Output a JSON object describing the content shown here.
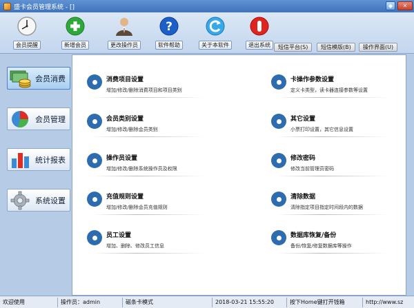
{
  "window": {
    "title": "盛卡会员管理系统 - []"
  },
  "toolbar": [
    {
      "label": "会员提醒",
      "icon": "clock-icon"
    },
    {
      "label": "新增会员",
      "icon": "plus-icon"
    },
    {
      "label": "更改操作员",
      "icon": "operator-icon"
    },
    {
      "label": "软件帮助",
      "icon": "help-icon"
    },
    {
      "label": "关于本软件",
      "icon": "about-icon"
    },
    {
      "label": "退出系统",
      "icon": "power-icon"
    }
  ],
  "right_tabs": [
    {
      "label": "短信平台(S)"
    },
    {
      "label": "短信模版(B)"
    },
    {
      "label": "操作界面(U)"
    }
  ],
  "nav": [
    {
      "label": "会员消费",
      "icon": "money-icon"
    },
    {
      "label": "会员管理",
      "icon": "pie-chart-icon"
    },
    {
      "label": "统计报表",
      "icon": "bar-chart-icon"
    },
    {
      "label": "系统设置",
      "icon": "gear-icon"
    }
  ],
  "cards": [
    {
      "title": "消费项目设置",
      "desc": "增加/修改/删除消费项目和项目类别"
    },
    {
      "title": "卡操作参数设置",
      "desc": "定义卡类型，读卡器连接参数等设置"
    },
    {
      "title": "会员类别设置",
      "desc": "增加/修改/删除会员类别"
    },
    {
      "title": "其它设置",
      "desc": "小票打印设置，其它信息设置"
    },
    {
      "title": "操作员设置",
      "desc": "增加/修改/删除系统操作员及权限"
    },
    {
      "title": "修改密码",
      "desc": "修改当前管理员密码"
    },
    {
      "title": "充值规则设置",
      "desc": "增加/修改/删除会员充值规则"
    },
    {
      "title": "清除数据",
      "desc": "清除指定项目指定时间段内的数据"
    },
    {
      "title": "员工设置",
      "desc": "增加、删除、修改员工信息"
    },
    {
      "title": "数据库恢复/备份",
      "desc": "备份/恢复/修复数据库等操作"
    }
  ],
  "status": {
    "welcome": "欢迎使用",
    "operator": "操作员：admin",
    "card_mode": "磁条卡模式",
    "datetime": "2018-03-21 15:55:20",
    "hint": "按下Home键打开钱箱",
    "url": "http://www.sz"
  },
  "colors": {
    "accent": "#2e6cb0",
    "background": "#b6cbe6",
    "titlebar": "#4a7fc4"
  }
}
